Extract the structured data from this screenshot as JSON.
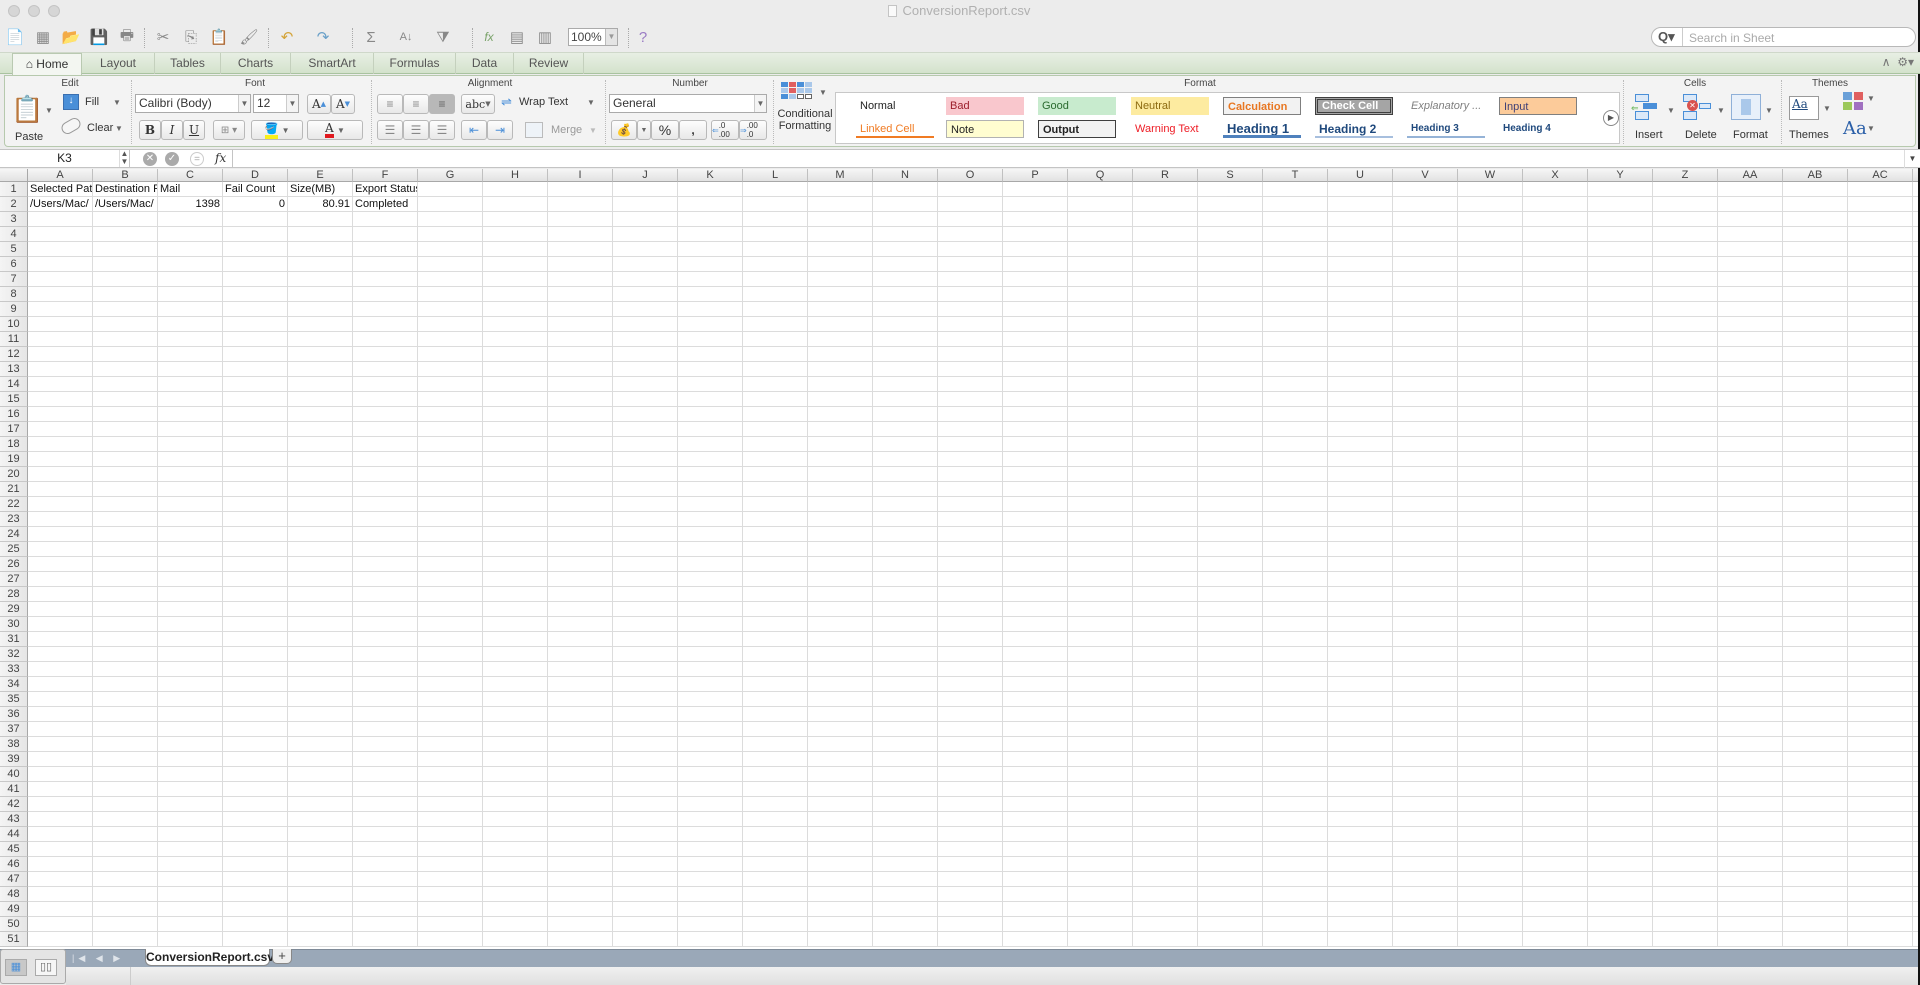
{
  "window": {
    "title": "ConversionReport.csv"
  },
  "toolbar": {
    "icons": [
      "new-icon",
      "templates-icon",
      "open-icon",
      "save-icon",
      "print-icon",
      "cut-icon",
      "copy-icon",
      "paste-icon",
      "format-painter-icon",
      "undo-icon",
      "redo-icon",
      "autosum-icon",
      "sort-icon",
      "filter-icon",
      "function-icon",
      "gallery-icon",
      "media-icon",
      "help-icon"
    ],
    "zoom": "100%",
    "search_placeholder": "Search in Sheet"
  },
  "tabs": [
    {
      "label": "Home",
      "active": true
    },
    {
      "label": "Layout"
    },
    {
      "label": "Tables"
    },
    {
      "label": "Charts"
    },
    {
      "label": "SmartArt"
    },
    {
      "label": "Formulas"
    },
    {
      "label": "Data"
    },
    {
      "label": "Review"
    }
  ],
  "ribbon": {
    "groups": {
      "edit": "Edit",
      "font": "Font",
      "alignment": "Alignment",
      "number": "Number",
      "format": "Format",
      "cells": "Cells",
      "themes": "Themes"
    },
    "edit": {
      "paste": "Paste",
      "fill": "Fill",
      "clear": "Clear"
    },
    "font": {
      "name": "Calibri (Body)",
      "size": "12",
      "bold": "B",
      "italic": "I",
      "underline": "U",
      "fill_color": "#f7ef1a",
      "font_color": "#e0181e"
    },
    "alignment": {
      "orientation": "abc",
      "wrap_text": "Wrap Text",
      "merge": "Merge"
    },
    "number": {
      "format": "General",
      "percent": "%",
      "comma": ",",
      "inc_decimal": ".0 .00",
      "dec_decimal": ".00 .0"
    },
    "conditional_formatting": "Conditional Formatting",
    "styles": [
      {
        "label": "Normal",
        "bg": "#ffffff",
        "fg": "#222222"
      },
      {
        "label": "Bad",
        "bg": "#f9c7cd",
        "fg": "#9c1f2c"
      },
      {
        "label": "Good",
        "bg": "#c8ebce",
        "fg": "#2a6b2f"
      },
      {
        "label": "Neutral",
        "bg": "#fdeba0",
        "fg": "#8c6a10"
      },
      {
        "label": "Calculation",
        "bg": "#f2f2f2",
        "fg": "#e87722"
      },
      {
        "label": "Check Cell",
        "bg": "#a5a5a5",
        "fg": "#ffffff"
      },
      {
        "label": "Explanatory ...",
        "bg": "#ffffff",
        "fg": "#7f7f7f"
      },
      {
        "label": "Input",
        "bg": "#fccb9a",
        "fg": "#3f3f76"
      },
      {
        "label": "Linked Cell",
        "bg": "#ffffff",
        "fg": "#f07b23"
      },
      {
        "label": "Note",
        "bg": "#fffdd0",
        "fg": "#222222"
      },
      {
        "label": "Output",
        "bg": "#f2f2f2",
        "fg": "#222222"
      },
      {
        "label": "Warning Text",
        "bg": "#ffffff",
        "fg": "#ee1c25"
      },
      {
        "label": "Heading 1",
        "bg": "#ffffff",
        "fg": "#1f497d"
      },
      {
        "label": "Heading 2",
        "bg": "#ffffff",
        "fg": "#1f497d"
      },
      {
        "label": "Heading 3",
        "bg": "#ffffff",
        "fg": "#1f497d"
      },
      {
        "label": "Heading 4",
        "bg": "#ffffff",
        "fg": "#1f497d"
      }
    ],
    "cells": {
      "insert": "Insert",
      "delete": "Delete",
      "format": "Format"
    },
    "themes": {
      "themes": "Themes",
      "fonts": "Aa"
    }
  },
  "formula_bar": {
    "name_box": "K3",
    "fx": "fx",
    "content": ""
  },
  "sheet": {
    "columns": [
      "A",
      "B",
      "C",
      "D",
      "E",
      "F",
      "G",
      "H",
      "I",
      "J",
      "K",
      "L",
      "M",
      "N",
      "O",
      "P",
      "Q",
      "R",
      "S",
      "T",
      "U",
      "V",
      "W",
      "X",
      "Y",
      "Z",
      "AA",
      "AB",
      "AC"
    ],
    "row_count": 51,
    "rows": [
      [
        {
          "v": "Selected Path"
        },
        {
          "v": "Destination Path"
        },
        {
          "v": "Mail"
        },
        {
          "v": "Fail Count"
        },
        {
          "v": "Size(MB)"
        },
        {
          "v": "Export Status"
        }
      ],
      [
        {
          "v": "/Users/Mac/"
        },
        {
          "v": "/Users/Mac/"
        },
        {
          "v": "1398",
          "num": true
        },
        {
          "v": "0",
          "num": true
        },
        {
          "v": "80.91",
          "num": true
        },
        {
          "v": "Completed"
        }
      ]
    ]
  },
  "sheet_tabs": [
    {
      "label": "ConversionReport.csv",
      "active": true
    }
  ],
  "add_sheet": "+"
}
